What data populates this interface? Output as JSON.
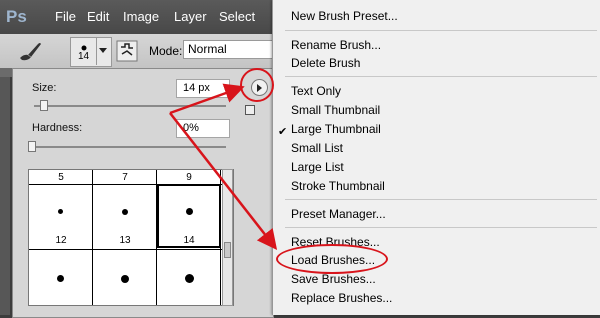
{
  "app": {
    "logo": "Ps"
  },
  "menubar": [
    "File",
    "Edit",
    "Image",
    "Layer",
    "Select"
  ],
  "options_bar": {
    "brush_tool_icon": "brush-icon",
    "preset_brush_size": "14",
    "mode_label": "Mode:",
    "mode_value": "Normal"
  },
  "brush_panel": {
    "size_label": "Size:",
    "size_value": "14 px",
    "size_slider_fraction": 0.05,
    "hardness_label": "Hardness:",
    "hardness_value": "0%",
    "hardness_slider_fraction": 0.0,
    "gear_icon": "flyout-arrow-icon",
    "grid_labels": [
      "5",
      "7",
      "9",
      "12",
      "13",
      "14"
    ],
    "selected_brush": "9"
  },
  "menu": {
    "items": [
      "New Brush Preset...",
      "Rename Brush...",
      "Delete Brush",
      "Text Only",
      "Small Thumbnail",
      "Large Thumbnail",
      "Small List",
      "Large List",
      "Stroke Thumbnail",
      "Preset Manager...",
      "Reset Brushes...",
      "Load Brushes...",
      "Save Brushes...",
      "Replace Brushes..."
    ],
    "checked_item": "Large Thumbnail",
    "highlighted_item": "Load Brushes..."
  },
  "colors": {
    "annotation_red": "#d8141b",
    "menu_background": "#f0f0f0",
    "panel_background": "#d6d6d6"
  }
}
